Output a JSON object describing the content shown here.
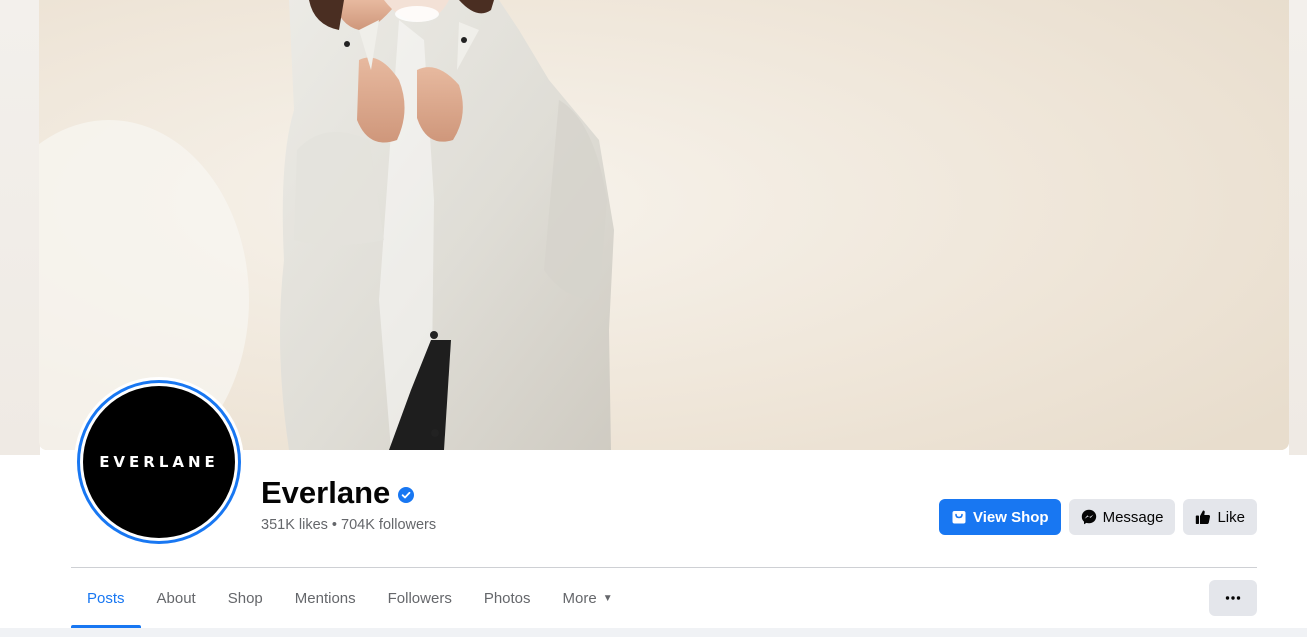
{
  "page": {
    "name": "Everlane",
    "stats": "351K likes • 704K followers",
    "avatar_text": "EVERLANE",
    "verified": true
  },
  "actions": {
    "view_shop": "View Shop",
    "message": "Message",
    "like": "Like"
  },
  "tabs": [
    {
      "label": "Posts",
      "active": true
    },
    {
      "label": "About",
      "active": false
    },
    {
      "label": "Shop",
      "active": false
    },
    {
      "label": "Mentions",
      "active": false
    },
    {
      "label": "Followers",
      "active": false
    },
    {
      "label": "Photos",
      "active": false
    },
    {
      "label": "More",
      "active": false
    }
  ],
  "colors": {
    "accent": "#1877f2",
    "text_primary": "#050505",
    "text_secondary": "#65676b",
    "button_secondary": "#e4e6eb"
  },
  "icons": {
    "verified": "verified-badge-icon",
    "shop": "shop-bag-icon",
    "message": "messenger-icon",
    "like": "thumbs-up-icon",
    "more": "ellipsis-icon",
    "caret": "caret-down-icon"
  }
}
